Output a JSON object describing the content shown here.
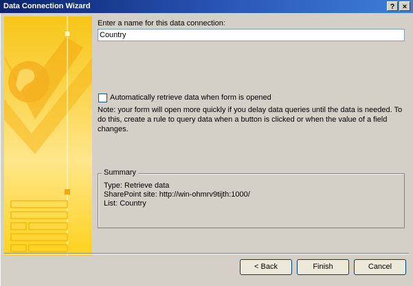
{
  "window": {
    "title": "Data Connection Wizard",
    "help_label": "?",
    "close_label": "×"
  },
  "main": {
    "name_prompt": "Enter a name for this data connection:",
    "name_value": "Country",
    "auto_retrieve_label": "Automatically retrieve data when form is opened",
    "auto_retrieve_checked": false,
    "note": "Note: your form will open more quickly if you delay data queries until the data is needed. To do this, create a rule to query data when a button is clicked or when the value of a field changes."
  },
  "summary": {
    "legend": "Summary",
    "lines": [
      "Type: Retrieve data",
      "SharePoint site: http://win-ohmrv9tijth:1000/",
      "List: Country"
    ]
  },
  "buttons": {
    "back": "< Back",
    "finish": "Finish",
    "cancel": "Cancel"
  }
}
